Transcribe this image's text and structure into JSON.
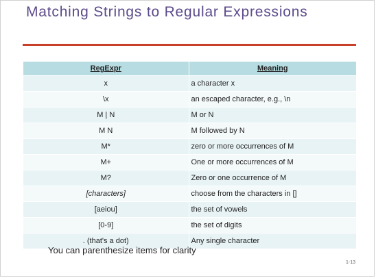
{
  "slide": {
    "title": "Matching Strings to Regular Expressions",
    "note": "You can parenthesize items for clarity",
    "page_number": "1-13"
  },
  "table": {
    "headers": [
      "RegExpr",
      "Meaning"
    ],
    "rows": [
      {
        "regex": "x",
        "meaning": "a character x"
      },
      {
        "regex": "\\x",
        "meaning": "an escaped character, e.g., \\n"
      },
      {
        "regex": "M | N",
        "meaning": "M or N"
      },
      {
        "regex": "M N",
        "meaning": "M followed by N"
      },
      {
        "regex": "M*",
        "meaning": "zero or more occurrences of M"
      },
      {
        "regex": "M+",
        "meaning": "One or more occurrences of M"
      },
      {
        "regex": "M?",
        "meaning": "Zero or one occurrence of M"
      },
      {
        "regex": "[characters]",
        "meaning": "choose from the characters in []"
      },
      {
        "regex": "[aeiou]",
        "meaning": "the set of vowels"
      },
      {
        "regex": "[0-9]",
        "meaning": "the set of digits"
      },
      {
        "regex": ". (that's a dot)",
        "meaning": "Any single character"
      }
    ]
  },
  "colors": {
    "title": "#5b4a8a",
    "rule": "#c8402a",
    "header_bg": "#b7dde3",
    "row_bg": "#e8f3f5"
  }
}
